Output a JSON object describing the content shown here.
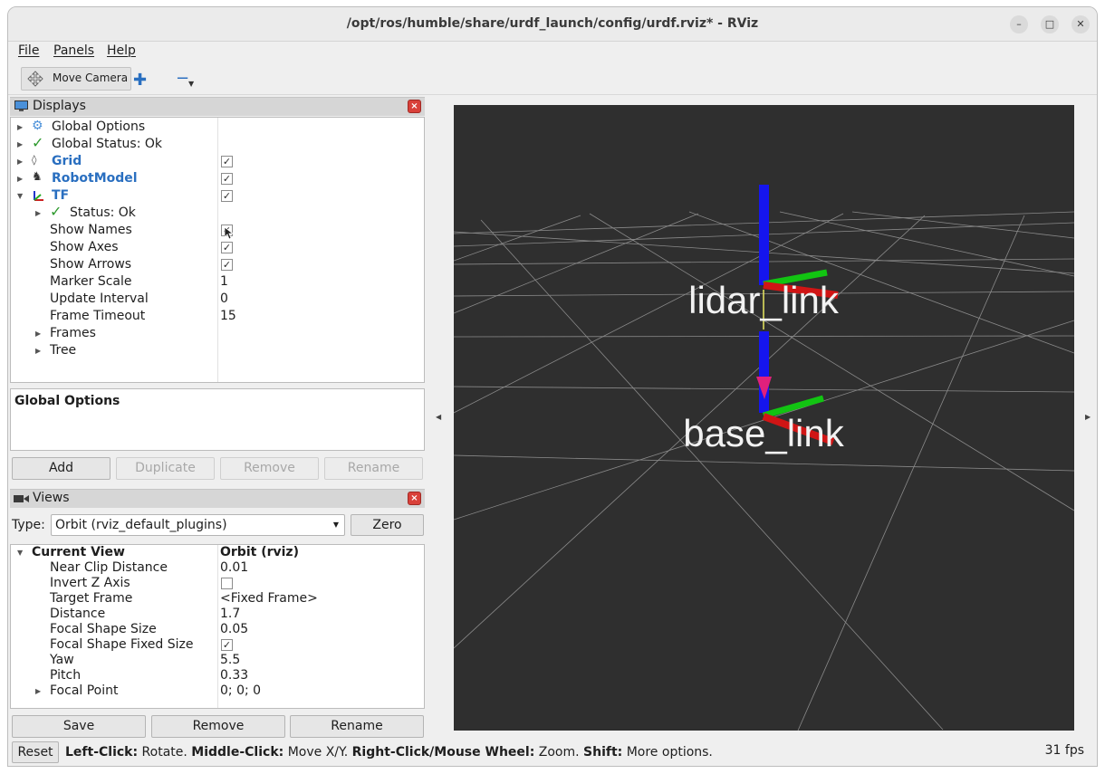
{
  "window": {
    "title": "/opt/ros/humble/share/urdf_launch/config/urdf.rviz* - RViz",
    "min_icon": "minimize-icon",
    "max_icon": "maximize-icon",
    "close_icon": "close-icon"
  },
  "menu": {
    "file": "File",
    "panels": "Panels",
    "help": "Help"
  },
  "toolbar": {
    "move_camera": "Move Camera"
  },
  "displays": {
    "header": "Displays",
    "items": [
      {
        "label": "Global Options",
        "icon": "gear-icon"
      },
      {
        "label": "Global Status: Ok",
        "icon": "check-icon"
      },
      {
        "label": "Grid",
        "icon": "grid-icon",
        "checked": true
      },
      {
        "label": "RobotModel",
        "icon": "robot-icon",
        "checked": true
      },
      {
        "label": "TF",
        "icon": "axes-icon",
        "checked": true
      }
    ],
    "tf_children": [
      {
        "label": "Status: Ok",
        "value": ""
      },
      {
        "label": "Show Names",
        "value": ""
      },
      {
        "label": "Show Axes",
        "value": ""
      },
      {
        "label": "Show Arrows",
        "value": ""
      },
      {
        "label": "Marker Scale",
        "value": "1"
      },
      {
        "label": "Update Interval",
        "value": "0"
      },
      {
        "label": "Frame Timeout",
        "value": "15"
      },
      {
        "label": "Frames",
        "value": ""
      },
      {
        "label": "Tree",
        "value": ""
      }
    ],
    "description_title": "Global Options",
    "buttons": {
      "add": "Add",
      "duplicate": "Duplicate",
      "remove": "Remove",
      "rename": "Rename"
    }
  },
  "views": {
    "header": "Views",
    "type_label": "Type:",
    "type_value": "Orbit (rviz_default_plugins)",
    "zero": "Zero",
    "current_view": "Current View",
    "current_view_value": "Orbit (rviz)",
    "props": [
      {
        "label": "Near Clip Distance",
        "value": "0.01"
      },
      {
        "label": "Invert Z Axis",
        "value": ""
      },
      {
        "label": "Target Frame",
        "value": "<Fixed Frame>"
      },
      {
        "label": "Distance",
        "value": "1.7"
      },
      {
        "label": "Focal Shape Size",
        "value": "0.05"
      },
      {
        "label": "Focal Shape Fixed Size",
        "value": ""
      },
      {
        "label": "Yaw",
        "value": "5.5"
      },
      {
        "label": "Pitch",
        "value": "0.33"
      },
      {
        "label": "Focal Point",
        "value": "0; 0; 0"
      }
    ],
    "buttons": {
      "save": "Save",
      "remove": "Remove",
      "rename": "Rename"
    }
  },
  "scene": {
    "frame1": "lidar_link",
    "frame2": "base_link"
  },
  "status": {
    "reset": "Reset",
    "k1": "Left-Click:",
    "v1": " Rotate. ",
    "k2": "Middle-Click:",
    "v2": " Move X/Y. ",
    "k3": "Right-Click/Mouse Wheel:",
    "v3": " Zoom. ",
    "k4": "Shift:",
    "v4": " More options.",
    "fps": "31 fps"
  }
}
